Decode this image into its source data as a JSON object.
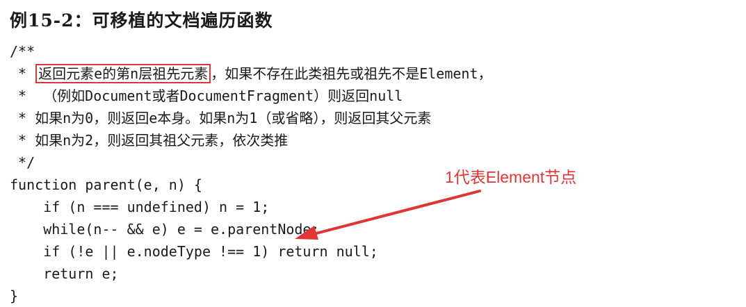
{
  "title": "例15-2：可移植的文档遍历函数",
  "code": {
    "line_0": "/**",
    "line_1_prefix": " * ",
    "line_1_highlight": "返回元素e的第n层祖先元素",
    "line_1_suffix": "，如果不存在此类祖先或祖先不是Element，",
    "line_2": " *  （例如Document或者DocumentFragment）则返回null",
    "line_3": " * 如果n为0，则返回e本身。如果n为1（或省略），则返回其父元素",
    "line_4": " * 如果n为2，则返回其祖父元素，依次类推",
    "line_5": " */",
    "line_6": "function parent(e, n) {",
    "line_7": "    if (n === undefined) n = 1;",
    "line_8": "    while(n-- && e) e = e.parentNode;",
    "line_9": "    if (!e || e.nodeType !== 1) return null;",
    "line_10": "    return e;",
    "line_11": "}"
  },
  "annotation": {
    "text": "1代表Element节点",
    "color": "#e03535"
  },
  "highlight_color": "#e03535"
}
